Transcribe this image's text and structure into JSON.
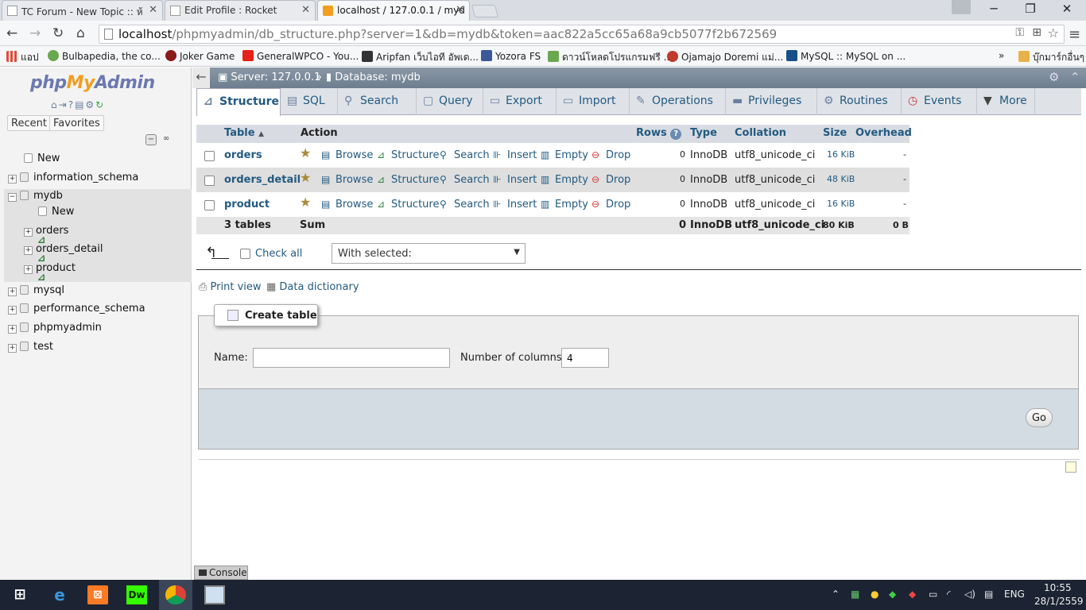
{
  "browser": {
    "tabs": [
      {
        "title": "TC Forum - New Topic :: ห้",
        "active": false
      },
      {
        "title": "Edit Profile : Rocket",
        "active": false
      },
      {
        "title": "localhost / 127.0.0.1 / myd",
        "active": true
      }
    ],
    "close_glyph": "✕",
    "url": {
      "host": "localhost",
      "path": "/phpmyadmin/db_structure.php?server=1&db=mydb&token=aac822a5cc65a68a9cb5077f2b672569"
    },
    "bookmarks": [
      {
        "label": "แอป",
        "color": "#e34b3b"
      },
      {
        "label": "Bulbapedia, the co...",
        "color": "#6aa84f"
      },
      {
        "label": "Joker Game",
        "color": "#8b1a1a"
      },
      {
        "label": "GeneralWPCO - You...",
        "color": "#e62117"
      },
      {
        "label": "Aripfan เว็บไอที อัพเด...",
        "color": "#333333"
      },
      {
        "label": "Yozora FS",
        "color": "#3b5998"
      },
      {
        "label": "ดาวน์โหลดโปรแกรมฟรี ...",
        "color": "#6aa84f"
      },
      {
        "label": "Ojamajo Doremi แม่...",
        "color": "#c0392b"
      },
      {
        "label": "MySQL :: MySQL on ...",
        "color": "#15508a"
      },
      {
        "label": "บุ๊กมาร์กอื่นๆ",
        "color": "#e8b24a"
      }
    ],
    "bookmarks_more": "»"
  },
  "sidebar": {
    "logo": {
      "php": "php",
      "my": "My",
      "admin": "Admin"
    },
    "recent_label": "Recent",
    "favorites_label": "Favorites",
    "tree": {
      "new": "New",
      "dbs_top": [
        "information_schema"
      ],
      "mydb": "mydb",
      "mydb_new": "New",
      "mydb_tables": [
        "orders",
        "orders_detail",
        "product"
      ],
      "dbs_bottom": [
        "mysql",
        "performance_schema",
        "phpmyadmin",
        "test"
      ]
    }
  },
  "breadcrumb": {
    "server": "Server: 127.0.0.1",
    "sep": "»",
    "database": "Database: mydb"
  },
  "menu": [
    {
      "label": "Structure",
      "icon": "structure-icon"
    },
    {
      "label": "SQL",
      "icon": "sql-icon"
    },
    {
      "label": "Search",
      "icon": "search-icon"
    },
    {
      "label": "Query",
      "icon": "query-icon"
    },
    {
      "label": "Export",
      "icon": "export-icon"
    },
    {
      "label": "Import",
      "icon": "import-icon"
    },
    {
      "label": "Operations",
      "icon": "wrench-icon"
    },
    {
      "label": "Privileges",
      "icon": "privileges-icon"
    },
    {
      "label": "Routines",
      "icon": "routines-icon"
    },
    {
      "label": "Events",
      "icon": "clock-icon"
    },
    {
      "label": "More",
      "icon": "chevron-down-icon"
    }
  ],
  "table": {
    "headers": {
      "table": "Table",
      "action": "Action",
      "rows": "Rows",
      "type": "Type",
      "collation": "Collation",
      "size": "Size",
      "overhead": "Overhead"
    },
    "actions": [
      "Browse",
      "Structure",
      "Search",
      "Insert",
      "Empty",
      "Drop"
    ],
    "rows": [
      {
        "name": "orders",
        "rows": "0",
        "type": "InnoDB",
        "collation": "utf8_unicode_ci",
        "size": "16 KiB",
        "overhead": "-"
      },
      {
        "name": "orders_detail",
        "rows": "0",
        "type": "InnoDB",
        "collation": "utf8_unicode_ci",
        "size": "48 KiB",
        "overhead": "-"
      },
      {
        "name": "product",
        "rows": "0",
        "type": "InnoDB",
        "collation": "utf8_unicode_ci",
        "size": "16 KiB",
        "overhead": "-"
      }
    ],
    "summary": {
      "tables": "3 tables",
      "label": "Sum",
      "rows": "0",
      "type": "InnoDB",
      "collation": "utf8_unicode_ci",
      "size": "80 KiB",
      "overhead": "0 B"
    }
  },
  "bulk": {
    "check_all": "Check all",
    "with_selected": "With selected:"
  },
  "links": {
    "print_view": "Print view",
    "data_dictionary": "Data dictionary"
  },
  "create_table": {
    "legend": "Create table",
    "name_label": "Name:",
    "name_value": "",
    "columns_label": "Number of columns:",
    "columns_value": "4",
    "go": "Go"
  },
  "console": {
    "label": "Console"
  },
  "taskbar": {
    "lang": "ENG",
    "time": "10:55",
    "date": "28/1/2559"
  }
}
